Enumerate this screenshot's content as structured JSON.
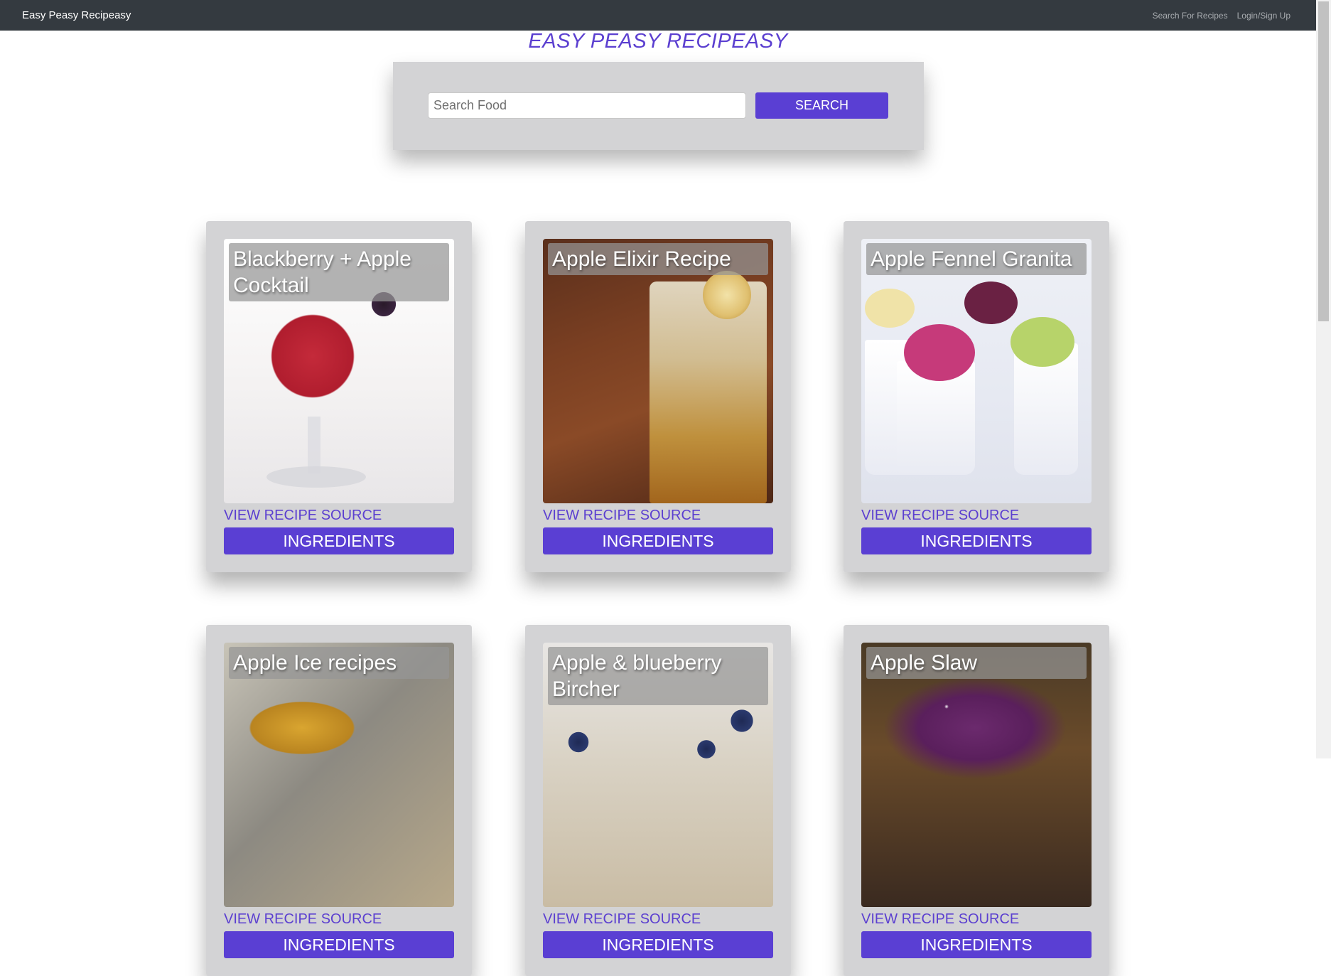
{
  "navbar": {
    "brand": "Easy Peasy Recipeasy",
    "links": [
      "Search For Recipes",
      "Login/Sign Up"
    ]
  },
  "hero": {
    "title": "EASY PEASY RECIPEASY"
  },
  "search": {
    "placeholder": "Search Food",
    "value": "",
    "button_label": "SEARCH"
  },
  "cards": [
    {
      "title": "Blackberry + Apple Cocktail",
      "link_label": "VIEW RECIPE SOURCE",
      "button_label": "INGREDIENTS"
    },
    {
      "title": "Apple Elixir Recipe",
      "link_label": "VIEW RECIPE SOURCE",
      "button_label": "INGREDIENTS"
    },
    {
      "title": "Apple Fennel Granita",
      "link_label": "VIEW RECIPE SOURCE",
      "button_label": "INGREDIENTS"
    },
    {
      "title": "Apple Ice recipes",
      "link_label": "VIEW RECIPE SOURCE",
      "button_label": "INGREDIENTS"
    },
    {
      "title": "Apple & blueberry Bircher",
      "link_label": "VIEW RECIPE SOURCE",
      "button_label": "INGREDIENTS"
    },
    {
      "title": "Apple Slaw",
      "link_label": "VIEW RECIPE SOURCE",
      "button_label": "INGREDIENTS"
    }
  ],
  "colors": {
    "navbar": "#343a40",
    "accent": "#5a3fd3",
    "card_bg": "#d3d3d5"
  }
}
